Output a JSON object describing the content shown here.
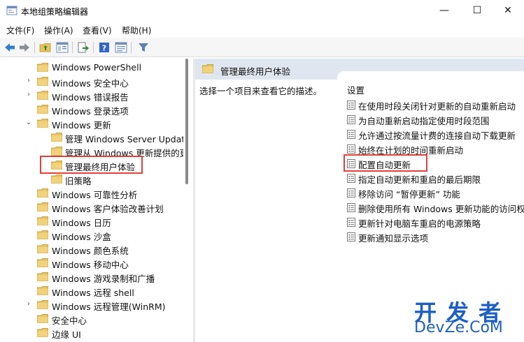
{
  "window": {
    "title": "本地组策略编辑器",
    "min_glyph": "—",
    "max_glyph": "☐",
    "close_glyph": "✕"
  },
  "menu": {
    "file": "文件(F)",
    "action": "操作(A)",
    "view": "查看(V)",
    "help": "帮助(H)"
  },
  "tree": {
    "items": [
      {
        "label": "Windows PowerShell",
        "expander": ""
      },
      {
        "label": "Windows 安全中心",
        "expander": "›"
      },
      {
        "label": "Windows 错误报告",
        "expander": "›"
      },
      {
        "label": "Windows 登录选项",
        "expander": ""
      },
      {
        "label": "Windows 更新",
        "expander": "⌄"
      },
      {
        "label": "管理 Windows Server Updat",
        "expander": ""
      },
      {
        "label": "管理从 Windows 更新提供的更",
        "expander": ""
      },
      {
        "label": "管理最终用户体验",
        "expander": ""
      },
      {
        "label": "旧策略",
        "expander": ""
      },
      {
        "label": "Windows 可靠性分析",
        "expander": ""
      },
      {
        "label": "Windows 客户体验改善计划",
        "expander": ""
      },
      {
        "label": "Windows 日历",
        "expander": ""
      },
      {
        "label": "Windows 沙盒",
        "expander": ""
      },
      {
        "label": "Windows 颜色系统",
        "expander": ""
      },
      {
        "label": "Windows 移动中心",
        "expander": ""
      },
      {
        "label": "Windows 游戏录制和广播",
        "expander": ""
      },
      {
        "label": "Windows 远程 shell",
        "expander": ""
      },
      {
        "label": "Windows 远程管理(WinRM)",
        "expander": "›"
      },
      {
        "label": "安全中心",
        "expander": ""
      },
      {
        "label": "边缘 UI",
        "expander": ""
      }
    ],
    "selected_index": 7
  },
  "right": {
    "header_title": "管理最终用户体验",
    "description": "选择一个项目来查看它的描述。",
    "list_header": "设置",
    "items": [
      "在使用时段关闭针对更新的自动重新启动",
      "为自动重新启动指定使用时段范围",
      "允许通过按流量计费的连接自动下载更新",
      "始终在计划的时间重新启动",
      "配置自动更新",
      "指定自动更新和重启的最后期限",
      "移除访问 “暂停更新” 功能",
      "删除使用所有 Windows 更新功能的访问权限",
      "更新针对电脑车重启的电源策略",
      "更新通知显示选项"
    ],
    "highlight_index": 4
  },
  "watermark": {
    "top": "开发者",
    "bottom": "DevZe.CoM"
  },
  "colors": {
    "highlight_border": "#e0403a",
    "folder": "#e8c25a",
    "watermark": "#1e5fc4",
    "header_bg": "#dfe6ef"
  }
}
